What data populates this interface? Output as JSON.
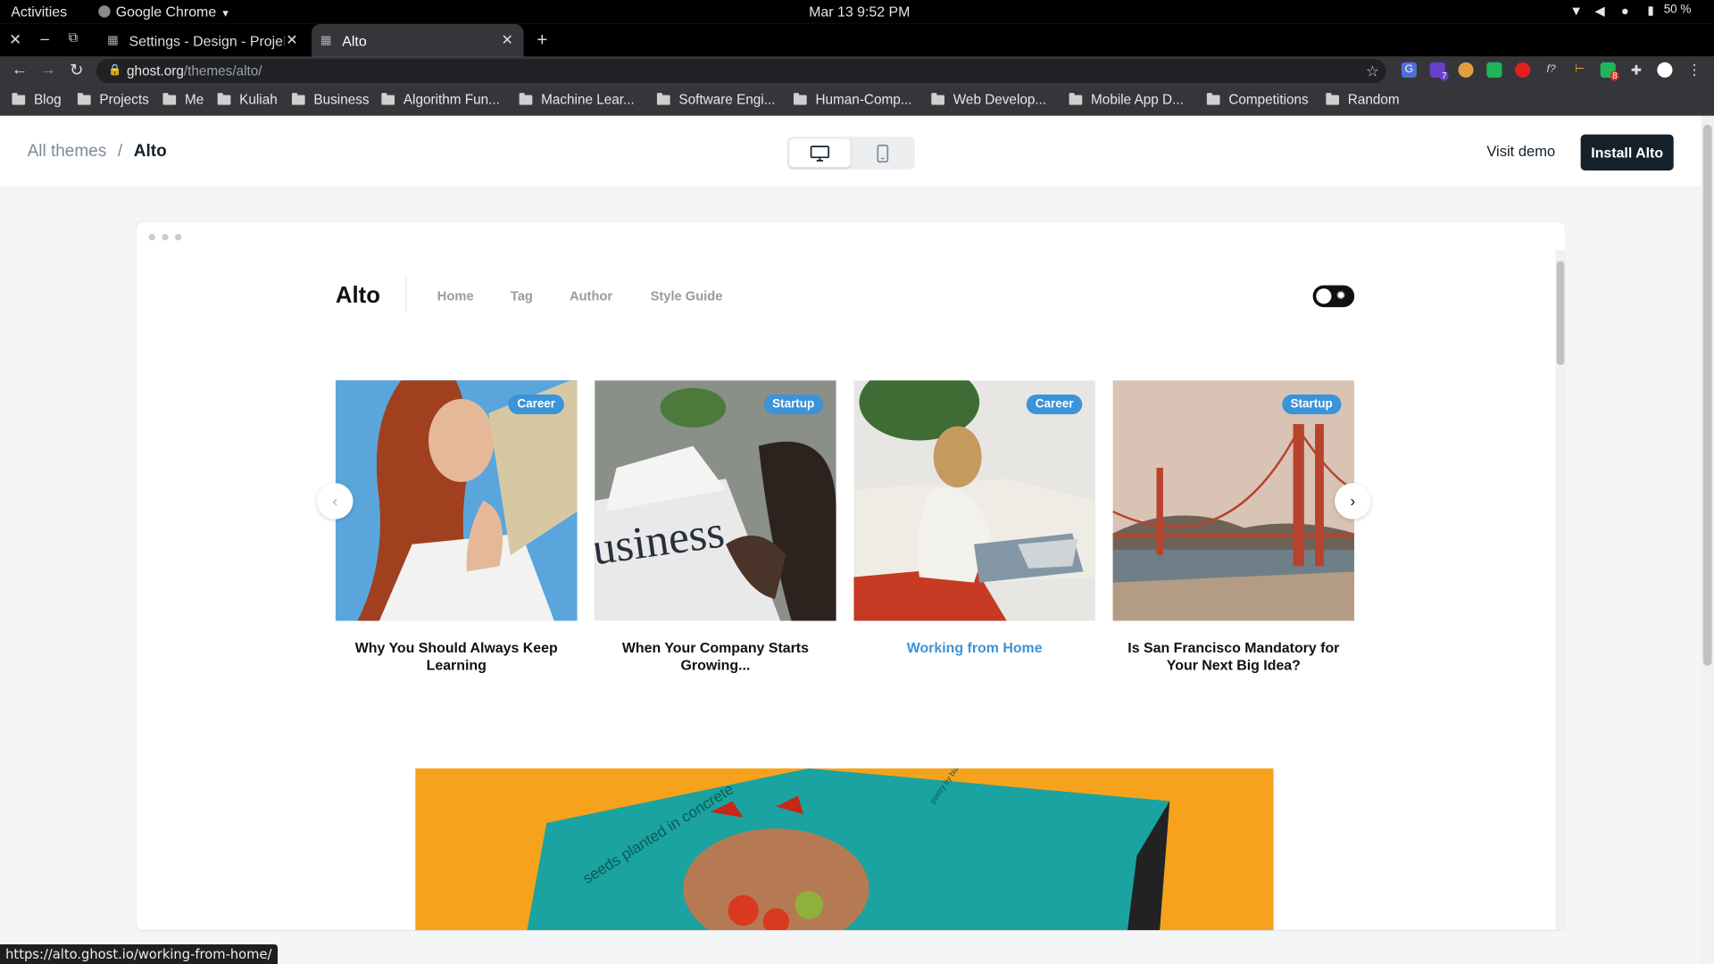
{
  "system_bar": {
    "activities": "Activities",
    "app": "Google Chrome",
    "clock": "Mar 13  9:52 PM",
    "battery": "50 %"
  },
  "tabs": [
    {
      "title": "Settings - Design - Projek",
      "active": false
    },
    {
      "title": "Alto",
      "active": true
    }
  ],
  "omnibox": {
    "host": "ghost.org",
    "path": "/themes/alto/"
  },
  "extensions": [
    {
      "name": "translate-icon",
      "badge": ""
    },
    {
      "name": "extension-purple-icon",
      "badge": "7"
    },
    {
      "name": "cookie-icon",
      "badge": ""
    },
    {
      "name": "extension-green-icon",
      "badge": ""
    },
    {
      "name": "extension-red-icon",
      "badge": ""
    },
    {
      "name": "formula-icon",
      "badge": ""
    },
    {
      "name": "extension-orange-icon",
      "badge": ""
    },
    {
      "name": "extension-chat-icon",
      "badge": "8"
    }
  ],
  "bookmarks": [
    "Blog",
    "Projects",
    "Me",
    "Kuliah",
    "Business",
    "Algorithm Fun...",
    "Machine Lear...",
    "Software Engi...",
    "Human-Comp...",
    "Web Develop...",
    "Mobile App D...",
    "Competitions",
    "Random"
  ],
  "header": {
    "crumb_parent": "All themes",
    "crumb_sep": "/",
    "crumb_current": "Alto",
    "visit_demo": "Visit demo",
    "install": "Install Alto"
  },
  "preview": {
    "logo": "Alto",
    "nav": [
      "Home",
      "Tag",
      "Author",
      "Style Guide"
    ],
    "cards": [
      {
        "tag": "Career",
        "title": "Why You Should Always Keep Learning",
        "image": "woman-reading-book",
        "highlight": false
      },
      {
        "tag": "Startup",
        "title": "When Your Company Starts Growing...",
        "image": "business-newspaper",
        "highlight": false
      },
      {
        "tag": "Career",
        "title": "Working from Home",
        "image": "woman-with-laptop",
        "highlight": true
      },
      {
        "tag": "Startup",
        "title": "Is San Francisco Mandatory for Your Next Big Idea?",
        "image": "golden-gate-bridge",
        "highlight": false
      }
    ],
    "hero": {
      "text": "seeds planted in concrete",
      "small_text": "poetry by bianca sparacino"
    }
  },
  "colors": {
    "accent": "#3b93d8",
    "dark": "#15212a",
    "hero_bg": "#f7a21c",
    "book": "#1aa3a0"
  },
  "status_url": "https://alto.ghost.io/working-from-home/"
}
